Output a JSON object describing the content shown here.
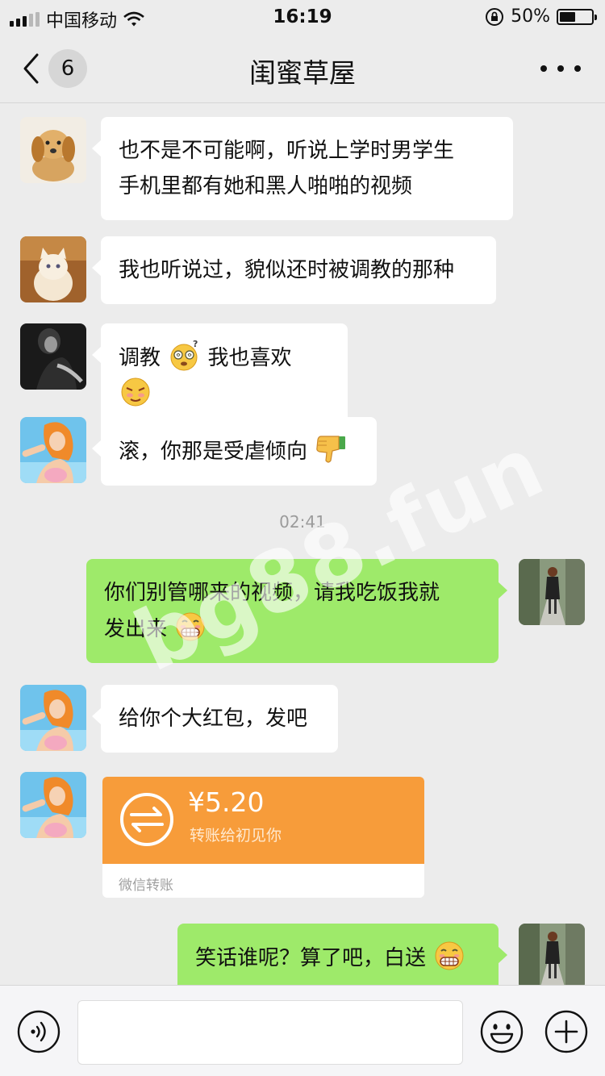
{
  "status": {
    "carrier": "中国移动",
    "time": "16:19",
    "battery": "50%",
    "battery_level": 0.5
  },
  "nav": {
    "unread_count": "6",
    "title": "闺蜜草屋"
  },
  "messages": [
    {
      "side": "left",
      "avatar": "puppy-avatar",
      "text": "也不是不可能啊，听说上学时男学生",
      "text2": "手机里都有她和黑人啪啪的视频"
    },
    {
      "side": "left",
      "avatar": "kitten-avatar",
      "text": "我也听说过，貌似还时被调教的那种"
    },
    {
      "side": "left",
      "avatar": "bw-portrait-avatar",
      "text_a": "调教",
      "text_b": "我也喜欢",
      "emojis": [
        "dizzy-face-emoji",
        "smirk-face-emoji"
      ]
    },
    {
      "side": "left",
      "avatar": "anime-girl-avatar",
      "text": "滚，你那是受虐倾向",
      "emojis": [
        "thumbs-down-emoji"
      ]
    },
    {
      "side": "right",
      "avatar": "street-photo-avatar",
      "text": "你们别管哪来的视频，请我吃饭我就",
      "text2": "发出来",
      "emojis": [
        "grin-emoji"
      ]
    },
    {
      "side": "left",
      "avatar": "anime-girl-avatar",
      "text": "给你个大红包，发吧"
    },
    {
      "side": "right",
      "avatar": "street-photo-avatar",
      "text": "笑话谁呢？算了吧，白送",
      "emojis": [
        "grin-emoji"
      ]
    }
  ],
  "timestamp": "02:41",
  "transfer": {
    "amount": "¥5.20",
    "note": "转账给初见你",
    "footer": "微信转账",
    "color": "#f79c3a"
  },
  "watermark": "bg88.fun",
  "colors": {
    "background": "#ececec",
    "bubble_self": "#9eea6a",
    "bubble_other": "#ffffff"
  }
}
